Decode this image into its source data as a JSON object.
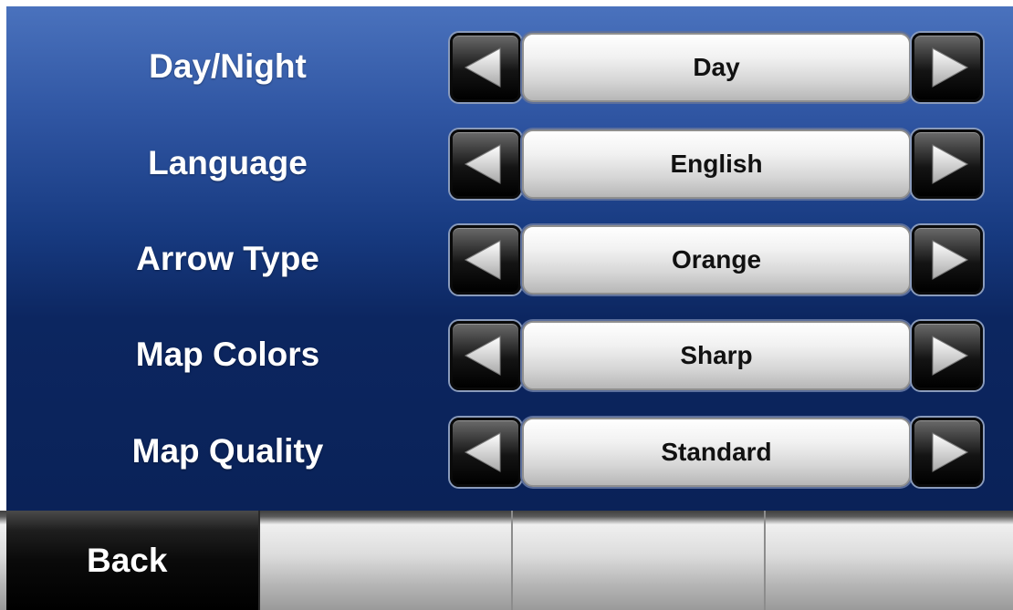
{
  "settings": [
    {
      "label": "Day/Night",
      "value": "Day"
    },
    {
      "label": "Language",
      "value": "English"
    },
    {
      "label": "Arrow Type",
      "value": "Orange"
    },
    {
      "label": "Map Colors",
      "value": "Sharp"
    },
    {
      "label": "Map Quality",
      "value": "Standard"
    }
  ],
  "bottom_bar": {
    "back_label": "Back"
  },
  "icons": {
    "left_arrow": "left-triangle-icon",
    "right_arrow": "right-triangle-icon"
  },
  "colors": {
    "panel_top": "#4a72bd",
    "panel_bottom": "#0a2258",
    "label_text": "#ffffff",
    "value_text": "#111111"
  }
}
